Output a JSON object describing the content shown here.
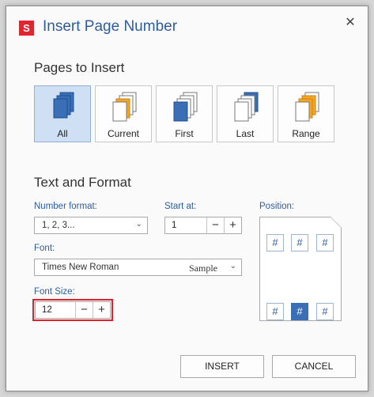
{
  "dialog": {
    "logo_letter": "S",
    "title": "Insert Page Number",
    "close_glyph": "✕"
  },
  "pages_section": {
    "heading": "Pages to Insert",
    "options": [
      {
        "label": "All",
        "icon": "all-pages-icon",
        "selected": true
      },
      {
        "label": "Current",
        "icon": "current-page-icon",
        "selected": false
      },
      {
        "label": "First",
        "icon": "first-page-icon",
        "selected": false
      },
      {
        "label": "Last",
        "icon": "last-page-icon",
        "selected": false
      },
      {
        "label": "Range",
        "icon": "range-pages-icon",
        "selected": false
      }
    ]
  },
  "format_section": {
    "heading": "Text and Format",
    "number_format": {
      "label": "Number format:",
      "value": "1, 2, 3..."
    },
    "start_at": {
      "label": "Start at:",
      "value": "1"
    },
    "font": {
      "label": "Font:",
      "value": "Times New Roman",
      "sample": "Sample"
    },
    "font_size": {
      "label": "Font Size:",
      "value": "12"
    },
    "position": {
      "label": "Position:",
      "glyph": "#",
      "selected": "bottom-center"
    }
  },
  "steppers": {
    "minus": "−",
    "plus": "+"
  },
  "buttons": {
    "insert": "INSERT",
    "cancel": "CANCEL"
  },
  "colors": {
    "accent": "#2e5d9f",
    "selected_bg": "#cfe0f4",
    "highlight": "#e0202a",
    "page_orange": "#f5a623",
    "page_blue": "#3a6eb5"
  }
}
